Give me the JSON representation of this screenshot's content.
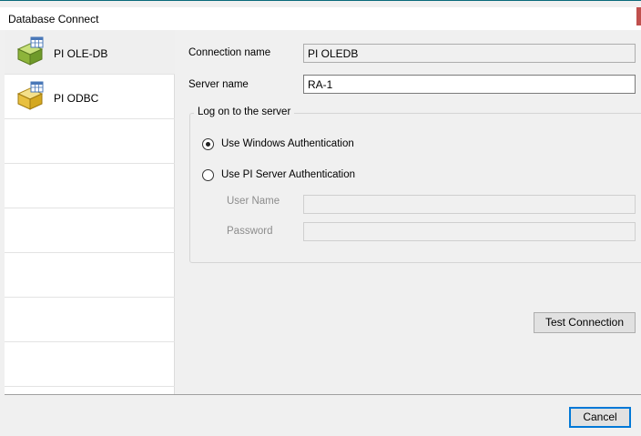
{
  "window": {
    "title": "Database Connect",
    "accent_color": "#0a6a7a",
    "close_accent_color": "#c0504d"
  },
  "sources": [
    {
      "label": "PI OLE-DB",
      "icon": "database-box-icon",
      "selected": true
    },
    {
      "label": "PI ODBC",
      "icon": "database-box-icon",
      "selected": false
    }
  ],
  "form": {
    "connection_name_label": "Connection name",
    "connection_name_value": "PI OLEDB",
    "server_name_label": "Server name",
    "server_name_value": "RA-1",
    "logon_group_title": "Log on to the server",
    "auth_windows_label": "Use Windows Authentication",
    "auth_pi_label": "Use PI Server Authentication",
    "auth_selected": "windows",
    "user_name_label": "User Name",
    "user_name_value": "",
    "password_label": "Password",
    "password_value": "",
    "test_connection_label": "Test Connection"
  },
  "footer": {
    "cancel_label": "Cancel"
  }
}
